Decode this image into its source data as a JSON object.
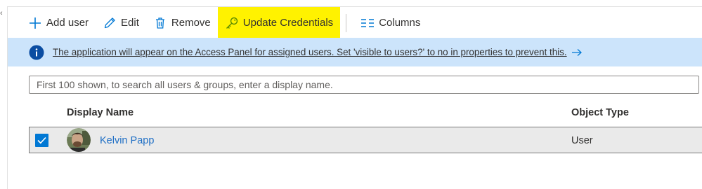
{
  "colors": {
    "accent": "#0078d4",
    "link": "#1f6fc5",
    "highlight": "#fff200",
    "banner_bg": "#cce4fb"
  },
  "toolbar": {
    "add_user": {
      "label": "Add user",
      "icon": "plus-icon"
    },
    "edit": {
      "label": "Edit",
      "icon": "pencil-icon"
    },
    "remove": {
      "label": "Remove",
      "icon": "trash-icon"
    },
    "update_credentials": {
      "label": "Update Credentials",
      "icon": "key-icon"
    },
    "columns": {
      "label": "Columns",
      "icon": "columns-icon"
    }
  },
  "banner": {
    "icon": "info-icon",
    "text": "The application will appear on the Access Panel for assigned users. Set 'visible to users?' to no in properties to prevent this.",
    "link_icon": "arrow-right-icon"
  },
  "search": {
    "placeholder": "First 100 shown, to search all users & groups, enter a display name.",
    "value": ""
  },
  "table": {
    "headers": [
      "Display Name",
      "Object Type"
    ],
    "rows": [
      {
        "selected": true,
        "name": "Kelvin Papp",
        "object_type": "User"
      }
    ]
  }
}
